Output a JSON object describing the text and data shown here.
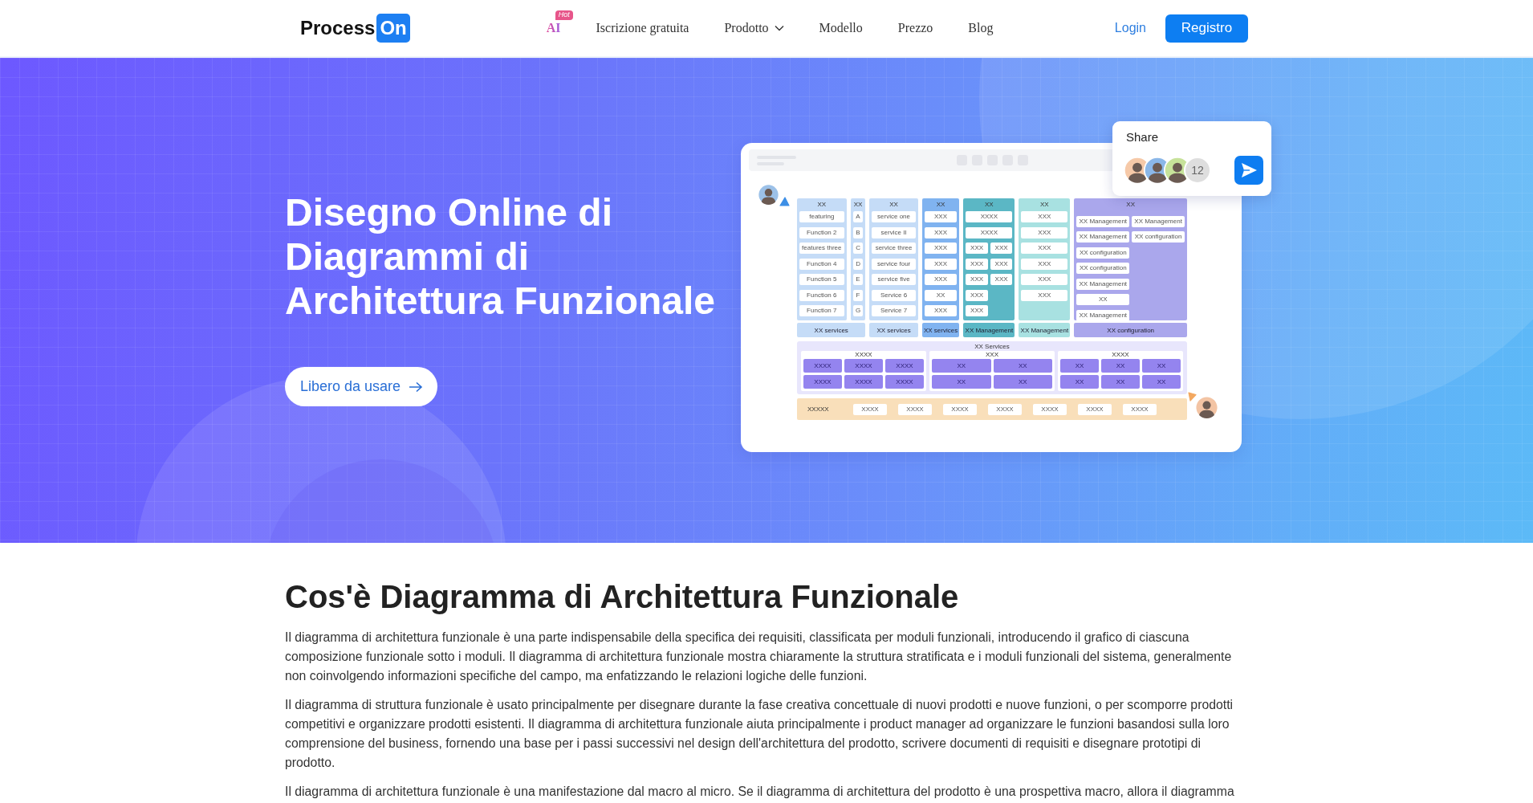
{
  "header": {
    "logo": {
      "text": "Process",
      "highlight": "On"
    },
    "nav": [
      {
        "kind": "featured",
        "label": "AI",
        "badge": "Hot"
      },
      {
        "kind": "link",
        "label": "Iscrizione gratuita"
      },
      {
        "kind": "dropdown",
        "label": "Prodotto"
      },
      {
        "kind": "link",
        "label": "Modello"
      },
      {
        "kind": "link",
        "label": "Prezzo"
      },
      {
        "kind": "link",
        "label": "Blog"
      }
    ],
    "login": "Login",
    "register": "Registro"
  },
  "hero": {
    "title": "Disegno Online di Diagrammi di Architettura Funzionale",
    "cta": "Libero da usare",
    "illustration": {
      "share": {
        "title": "Share",
        "count": "12"
      },
      "diagram": {
        "sections": [
          {
            "label": "XX services",
            "color": "#c5dcf7",
            "columns": [
              {
                "title": "XX",
                "items": [
                  "featuring",
                  "Function 2",
                  "features three",
                  "Function 4",
                  "Function 5",
                  "Function 6",
                  "Function 7"
                ]
              },
              {
                "title": "XX",
                "items": [
                  "A",
                  "B",
                  "C",
                  "D",
                  "E",
                  "F",
                  "G"
                ]
              }
            ]
          },
          {
            "label": "XX services",
            "color": "#c5dcf7",
            "columns": [
              {
                "title": "XX",
                "items": [
                  "service one",
                  "service II",
                  "service three",
                  "service four",
                  "service five",
                  "Service 6",
                  "Service 7"
                ]
              }
            ]
          },
          {
            "label": "XX services",
            "color": "#80b3f0",
            "columns": [
              {
                "title": "XX",
                "items": [
                  "XXX",
                  "XXX",
                  "XXX",
                  "XXX",
                  "XXX",
                  "XX",
                  "XXX"
                ]
              }
            ]
          },
          {
            "label": "XX Management",
            "color": "#5bb7c5",
            "columns": [
              {
                "title": "XX",
                "items": [
                  "XXXX",
                  "XXXX"
                ],
                "sub_columns": [
                  [
                    "XXX",
                    "XXX",
                    "XXX",
                    "XXX",
                    "XXX"
                  ],
                  [
                    "XXX",
                    "XXX",
                    "XXX"
                  ]
                ]
              }
            ]
          },
          {
            "label": "XX Management",
            "color": "#a8e1e1",
            "columns": [
              {
                "title": "XX",
                "items": [
                  "XXX",
                  "XXX",
                  "XXX",
                  "XXX",
                  "XXX",
                  "XXX"
                ]
              }
            ]
          },
          {
            "label": "XX configuration",
            "color": "#aaa7ec",
            "columns": [
              {
                "title": "XX",
                "sub_columns": [
                  [
                    "XX Management",
                    "XX Management",
                    "XX configuration",
                    "XX configuration",
                    "XX Management",
                    "XX",
                    "XX Management"
                  ],
                  [
                    "XX Management",
                    "XX configuration"
                  ]
                ]
              }
            ]
          }
        ],
        "services": {
          "title": "XX Services",
          "groups": [
            {
              "title": "XXXX",
              "items": [
                "XXXX",
                "XXXX",
                "XXXX",
                "XXXX",
                "XXXX",
                "XXXX"
              ]
            },
            {
              "title": "XXX",
              "items": [
                "XX",
                "XX",
                "XX",
                "XX"
              ]
            },
            {
              "title": "XXXX",
              "items": [
                "XX",
                "XX",
                "XX",
                "XX",
                "XX",
                "XX"
              ]
            }
          ]
        },
        "strip": {
          "label": "XXXXX",
          "items": [
            "XXXX",
            "XXXX",
            "XXXX",
            "XXXX",
            "XXXX",
            "XXXX",
            "XXXX"
          ]
        }
      }
    }
  },
  "article": {
    "heading": "Cos'è Diagramma di Architettura Funzionale",
    "paragraphs": [
      "Il diagramma di architettura funzionale è una parte indispensabile della specifica dei requisiti, classificata per moduli funzionali, introducendo il grafico di ciascuna composizione funzionale sotto i moduli. Il diagramma di architettura funzionale mostra chiaramente la struttura stratificata e i moduli funzionali del sistema, generalmente non coinvolgendo informazioni specifiche del campo, ma enfatizzando le relazioni logiche delle funzioni.",
      "Il diagramma di struttura funzionale è usato principalmente per disegnare durante la fase creativa concettuale di nuovi prodotti e nuove funzioni, o per scomporre prodotti competitivi e organizzare prodotti esistenti. Il diagramma di architettura funzionale aiuta principalmente i product manager ad organizzare le funzioni basandosi sulla loro comprensione del business, fornendo una base per i passi successivi nel design dell'architettura del prodotto, scrivere documenti di requisiti e disegnare prototipi di prodotto.",
      "Il diagramma di architettura funzionale è una manifestazione dal macro al micro. Se il diagramma di architettura del prodotto è una prospettiva macro, allora il diagramma"
    ]
  }
}
